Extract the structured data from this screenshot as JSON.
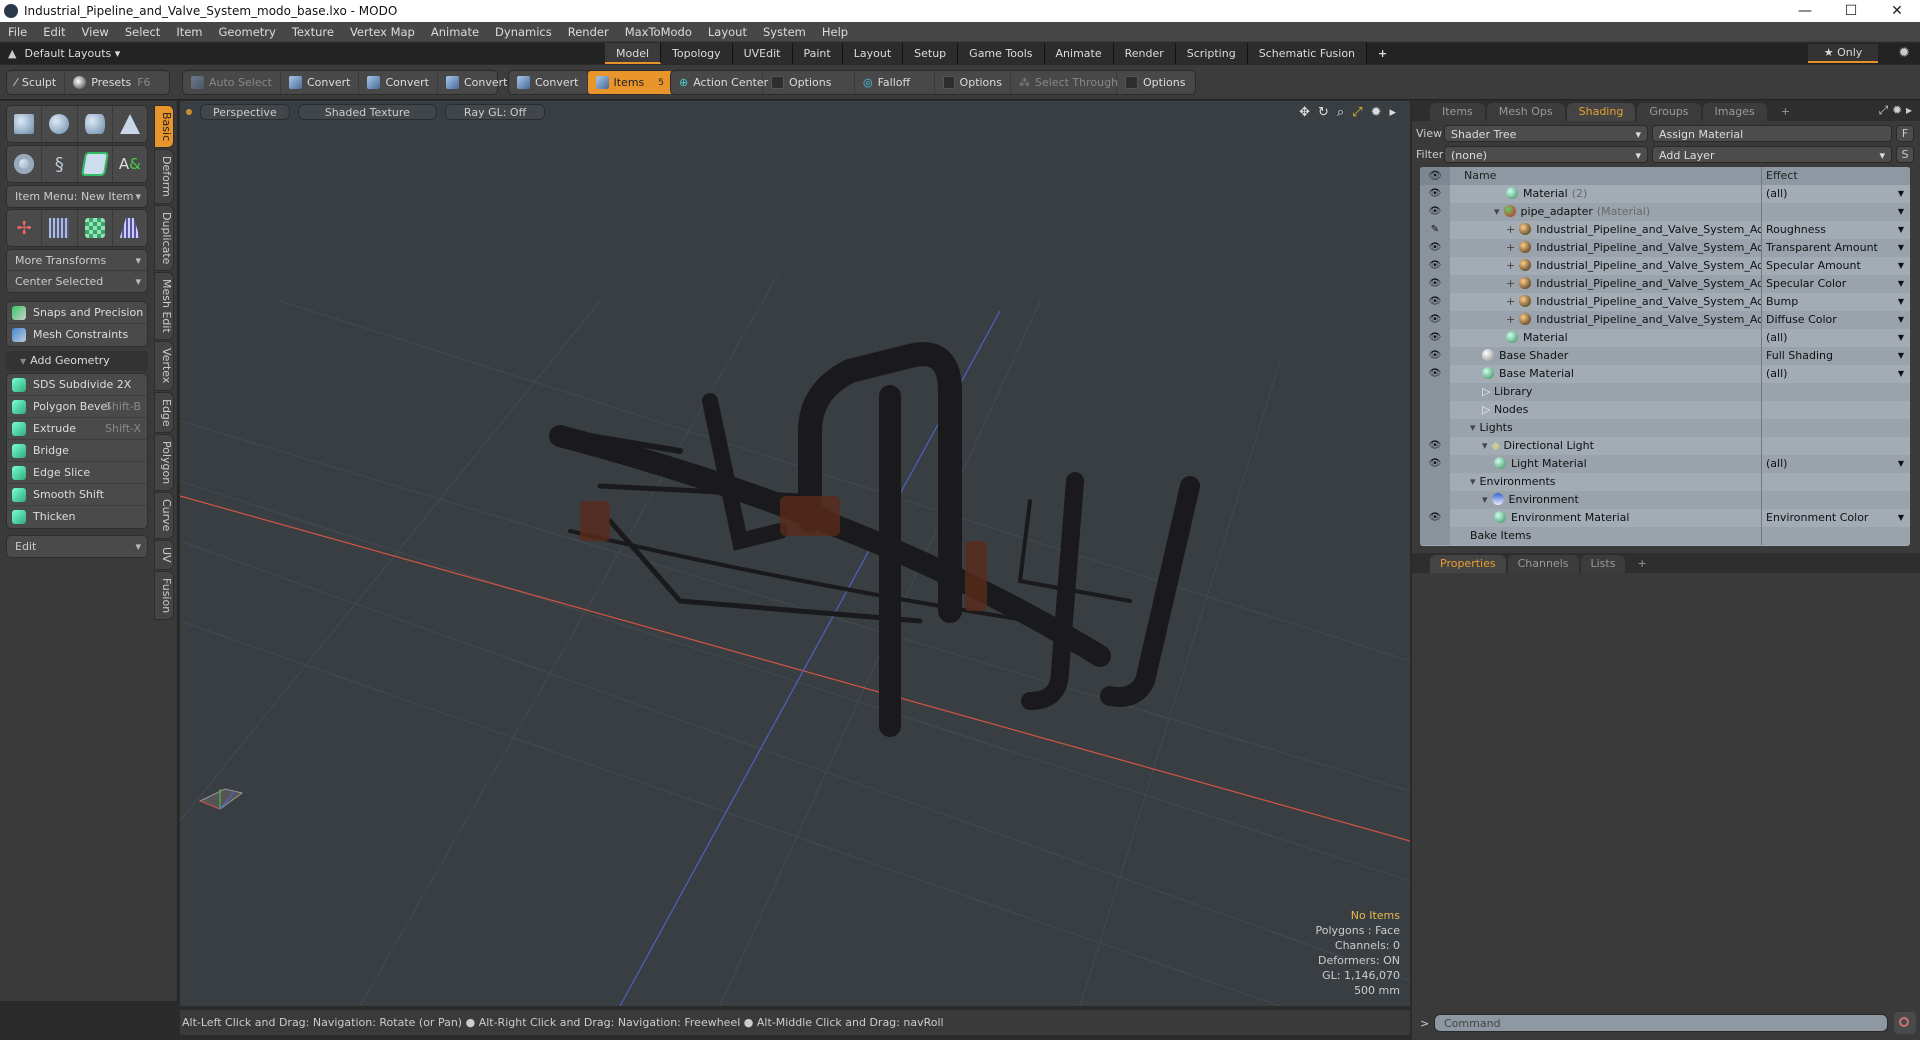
{
  "window": {
    "title": "Industrial_Pipeline_and_Valve_System_modo_base.lxo - MODO",
    "minimize": "—",
    "maximize": "☐",
    "close": "✕"
  },
  "menu": [
    "File",
    "Edit",
    "View",
    "Select",
    "Item",
    "Geometry",
    "Texture",
    "Vertex Map",
    "Animate",
    "Dynamics",
    "Render",
    "MaxToModo",
    "Layout",
    "System",
    "Help"
  ],
  "layoutbar": {
    "layouts_label": "Default Layouts ▾",
    "tabs": [
      "Model",
      "Topology",
      "UVEdit",
      "Paint",
      "Layout",
      "Setup",
      "Game Tools",
      "Animate",
      "Render",
      "Scripting",
      "Schematic Fusion"
    ],
    "active_tab": "Model",
    "add": "+",
    "only": "★ Only"
  },
  "toolbar": {
    "sculpt": "Sculpt",
    "presets": "Presets",
    "presets_key": "F6",
    "auto_select": "Auto Select",
    "convert": "Convert",
    "items": "Items",
    "items_badge": "5",
    "action_center": "Action Center",
    "options": "Options",
    "falloff": "Falloff",
    "select_through": "Select Through"
  },
  "left_panel": {
    "side_tabs": [
      "Basic",
      "Deform",
      "Duplicate",
      "Mesh Edit",
      "Vertex",
      "Edge",
      "Polygon",
      "Curve",
      "UV",
      "Fusion"
    ],
    "active_side_tab": "Basic",
    "item_menu": "Item Menu: New Item",
    "more_transforms": "More Transforms",
    "center_selected": "Center Selected",
    "snaps": "Snaps and Precision",
    "mesh_constraints": "Mesh Constraints",
    "add_geometry": "Add Geometry",
    "tools": [
      {
        "label": "SDS Subdivide 2X",
        "shortcut": ""
      },
      {
        "label": "Polygon Bevel",
        "shortcut": "Shift-B"
      },
      {
        "label": "Extrude",
        "shortcut": "Shift-X"
      },
      {
        "label": "Bridge",
        "shortcut": ""
      },
      {
        "label": "Edge Slice",
        "shortcut": ""
      },
      {
        "label": "Smooth Shift",
        "shortcut": ""
      },
      {
        "label": "Thicken",
        "shortcut": ""
      }
    ],
    "edit": "Edit"
  },
  "viewport": {
    "view": "Perspective",
    "shading": "Shaded Texture",
    "raygl": "Ray GL: Off",
    "info": {
      "selection": "No Items",
      "polygons": "Polygons : Face",
      "channels": "Channels: 0",
      "deformers": "Deformers: ON",
      "gl": "GL: 1,146,070",
      "scale": "500 mm"
    }
  },
  "status": "Alt-Left Click and Drag: Navigation: Rotate (or Pan) ● Alt-Right Click and Drag: Navigation: Freewheel ● Alt-Middle Click and Drag: navRoll",
  "right_panel": {
    "tabs": [
      "Items",
      "Mesh Ops",
      "Shading",
      "Groups",
      "Images"
    ],
    "active_tab": "Shading",
    "view_label": "View",
    "view_value": "Shader Tree",
    "assign_material": "Assign Material",
    "f_btn": "F",
    "filter_label": "Filter",
    "filter_value": "(none)",
    "add_layer": "Add Layer",
    "s_btn": "S",
    "columns": {
      "name": "Name",
      "effect": "Effect"
    },
    "rows": [
      {
        "indent": 4,
        "icon": "g",
        "name": "Material",
        "suffix": "(2)",
        "effect": "(all)",
        "eye": "👁",
        "drop": true
      },
      {
        "indent": 3,
        "icon": "r",
        "name": "pipe_adapter",
        "suffix": "(Material)",
        "effect": "",
        "eye": "👁",
        "drop": true,
        "expander": "▾"
      },
      {
        "indent": 4,
        "icon": "o",
        "name": "Industrial_Pipeline_and_Valve_System_Ada ...",
        "suffix": "",
        "effect": "Roughness",
        "eye": "✎",
        "drop": true,
        "expander": "+"
      },
      {
        "indent": 4,
        "icon": "o",
        "name": "Industrial_Pipeline_and_Valve_System_Ada ...",
        "suffix": "",
        "effect": "Transparent Amount",
        "eye": "👁",
        "drop": true,
        "expander": "+"
      },
      {
        "indent": 4,
        "icon": "o",
        "name": "Industrial_Pipeline_and_Valve_System_Ada ...",
        "suffix": "",
        "effect": "Specular Amount",
        "eye": "👁",
        "drop": true,
        "expander": "+"
      },
      {
        "indent": 4,
        "icon": "o",
        "name": "Industrial_Pipeline_and_Valve_System_Ada ...",
        "suffix": "",
        "effect": "Specular Color",
        "eye": "👁",
        "drop": true,
        "expander": "+"
      },
      {
        "indent": 4,
        "icon": "o",
        "name": "Industrial_Pipeline_and_Valve_System_Ada ...",
        "suffix": "",
        "effect": "Bump",
        "eye": "👁",
        "drop": true,
        "expander": "+"
      },
      {
        "indent": 4,
        "icon": "o",
        "name": "Industrial_Pipeline_and_Valve_System_Ada ...",
        "suffix": "",
        "effect": "Diffuse Color",
        "eye": "👁",
        "drop": true,
        "expander": "+"
      },
      {
        "indent": 4,
        "icon": "g",
        "name": "Material",
        "suffix": "",
        "effect": "(all)",
        "eye": "👁",
        "drop": true
      },
      {
        "indent": 2,
        "icon": "w",
        "name": "Base Shader",
        "suffix": "",
        "effect": "Full Shading",
        "eye": "👁",
        "drop": true
      },
      {
        "indent": 2,
        "icon": "g",
        "name": "Base Material",
        "suffix": "",
        "effect": "(all)",
        "eye": "👁",
        "drop": true
      },
      {
        "indent": 2,
        "icon": "folder",
        "name": "Library",
        "suffix": "",
        "effect": "",
        "eye": ""
      },
      {
        "indent": 2,
        "icon": "folder",
        "name": "Nodes",
        "suffix": "",
        "effect": "",
        "eye": ""
      },
      {
        "indent": 1,
        "icon": "",
        "name": "Lights",
        "suffix": "",
        "effect": "",
        "eye": "",
        "expander": "▾"
      },
      {
        "indent": 2,
        "icon": "light",
        "name": "Directional Light",
        "suffix": "",
        "effect": "",
        "eye": "👁",
        "expander": "▾"
      },
      {
        "indent": 3,
        "icon": "g",
        "name": "Light Material",
        "suffix": "",
        "effect": "(all)",
        "eye": "👁",
        "drop": true
      },
      {
        "indent": 1,
        "icon": "",
        "name": "Environments",
        "suffix": "",
        "effect": "",
        "eye": "",
        "expander": "▾"
      },
      {
        "indent": 2,
        "icon": "env",
        "name": "Environment",
        "suffix": "",
        "effect": "",
        "eye": "",
        "expander": "▾"
      },
      {
        "indent": 3,
        "icon": "g",
        "name": "Environment Material",
        "suffix": "",
        "effect": "Environment Color",
        "eye": "👁",
        "drop": true
      },
      {
        "indent": 1,
        "icon": "",
        "name": "Bake Items",
        "suffix": "",
        "effect": "",
        "eye": ""
      }
    ],
    "bottom_tabs": [
      "Properties",
      "Channels",
      "Lists"
    ],
    "bottom_active": "Properties"
  },
  "command": {
    "prompt": ">",
    "placeholder": "Command"
  }
}
